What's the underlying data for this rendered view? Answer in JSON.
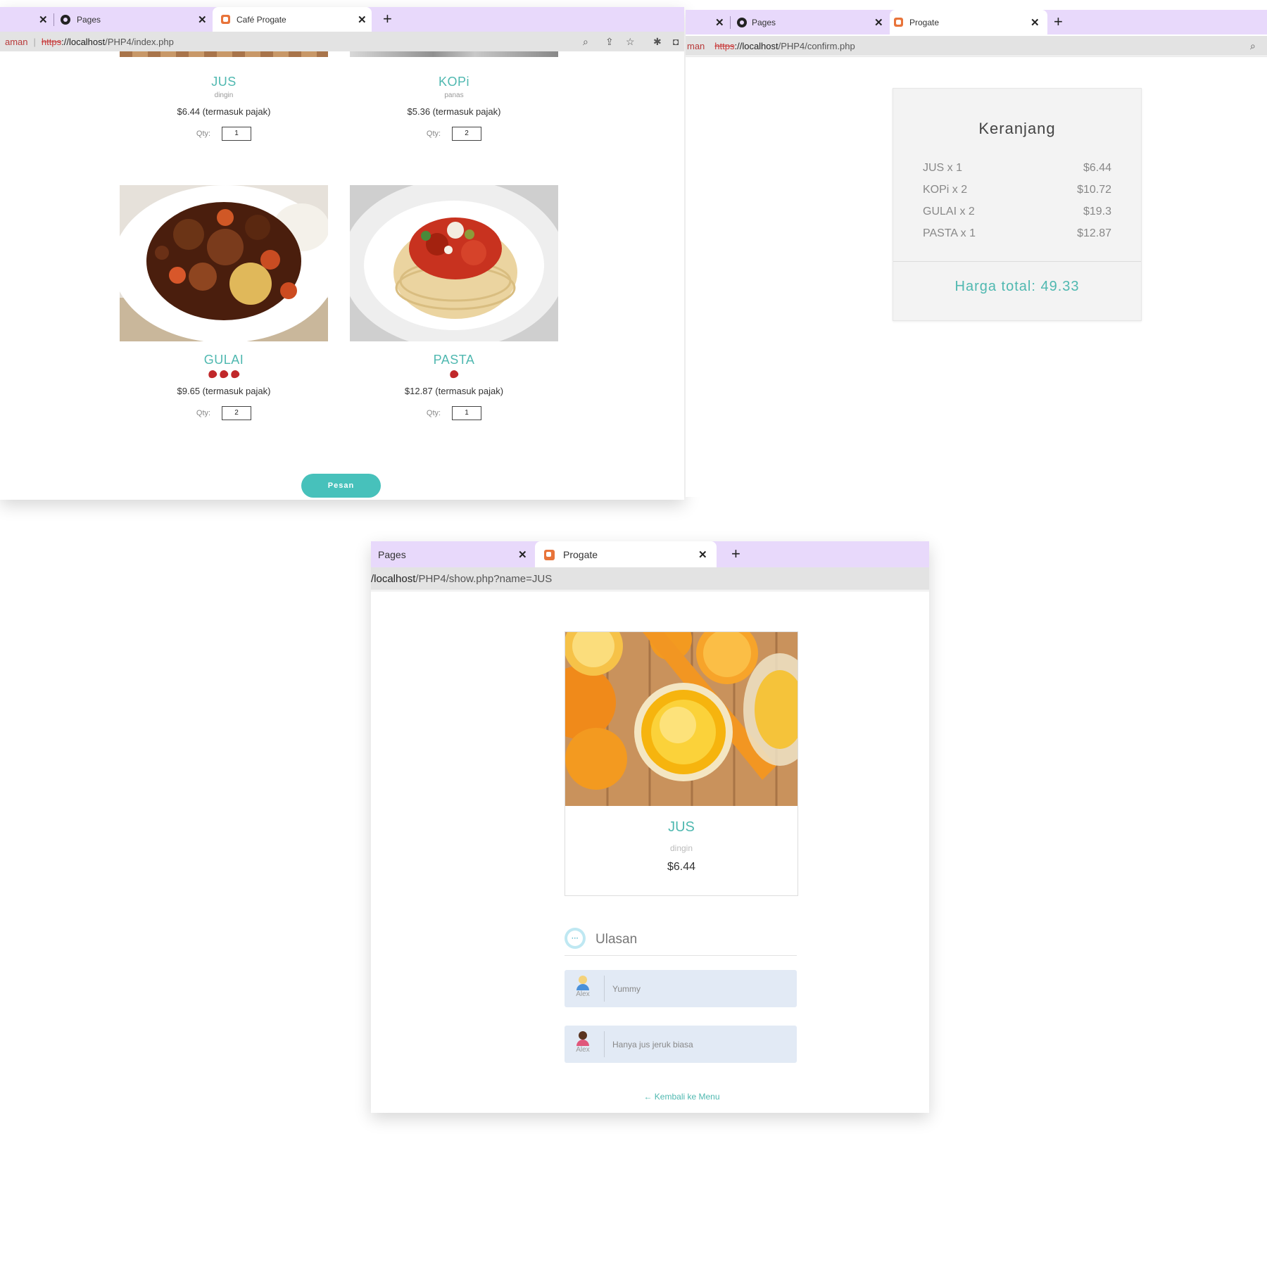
{
  "window_menu": {
    "tabs": [
      {
        "label": ""
      },
      {
        "label": "Pages"
      },
      {
        "label": "Café Progate"
      }
    ],
    "new_tab": "+",
    "address": {
      "prefix": "aman",
      "scheme": "https",
      "host": "://localhost",
      "path": "/PHP4/index.php"
    },
    "items": [
      {
        "name": "JUS",
        "subtitle": "dingin",
        "price": "$6.44 (termasuk pajak)",
        "qty_label": "Qty:",
        "qty": "1",
        "spiciness": 0
      },
      {
        "name": "KOPi",
        "subtitle": "panas",
        "price": "$5.36 (termasuk pajak)",
        "qty_label": "Qty:",
        "qty": "2",
        "spiciness": 0
      },
      {
        "name": "GULAI",
        "subtitle": "",
        "price": "$9.65 (termasuk pajak)",
        "qty_label": "Qty:",
        "qty": "2",
        "spiciness": 3
      },
      {
        "name": "PASTA",
        "subtitle": "",
        "price": "$12.87 (termasuk pajak)",
        "qty_label": "Qty:",
        "qty": "1",
        "spiciness": 1
      }
    ],
    "order_button": "Pesan"
  },
  "window_confirm": {
    "tabs": [
      {
        "label": ""
      },
      {
        "label": "Pages"
      },
      {
        "label": "Progate"
      }
    ],
    "new_tab": "+",
    "address": {
      "prefix": "man",
      "scheme": "https",
      "host": "://localhost",
      "path": "/PHP4/confirm.php"
    },
    "cart": {
      "title": "Keranjang",
      "rows": [
        {
          "label": "JUS x 1",
          "amount": "$6.44"
        },
        {
          "label": "KOPi x 2",
          "amount": "$10.72"
        },
        {
          "label": "GULAI x 2",
          "amount": "$19.3"
        },
        {
          "label": "PASTA x 1",
          "amount": "$12.87"
        }
      ],
      "total": "Harga total: 49.33"
    }
  },
  "window_show": {
    "tabs": [
      {
        "label": "Pages"
      },
      {
        "label": "Progate"
      }
    ],
    "new_tab": "+",
    "address": {
      "host": "/localhost",
      "path": "/PHP4/show.php?name=JUS"
    },
    "product": {
      "name": "JUS",
      "subtitle": "dingin",
      "price": "$6.44"
    },
    "reviews_title": "Ulasan",
    "reviews": [
      {
        "author": "Alex",
        "text": "Yummy"
      },
      {
        "author": "Alex",
        "text": "Hanya jus jeruk biasa"
      }
    ],
    "back_link": "← Kembali ke Menu"
  },
  "colors": {
    "accent": "#4fb8b0",
    "tabbar": "#e8d9fb",
    "button": "#47c1bb",
    "chili": "#c0282a"
  }
}
